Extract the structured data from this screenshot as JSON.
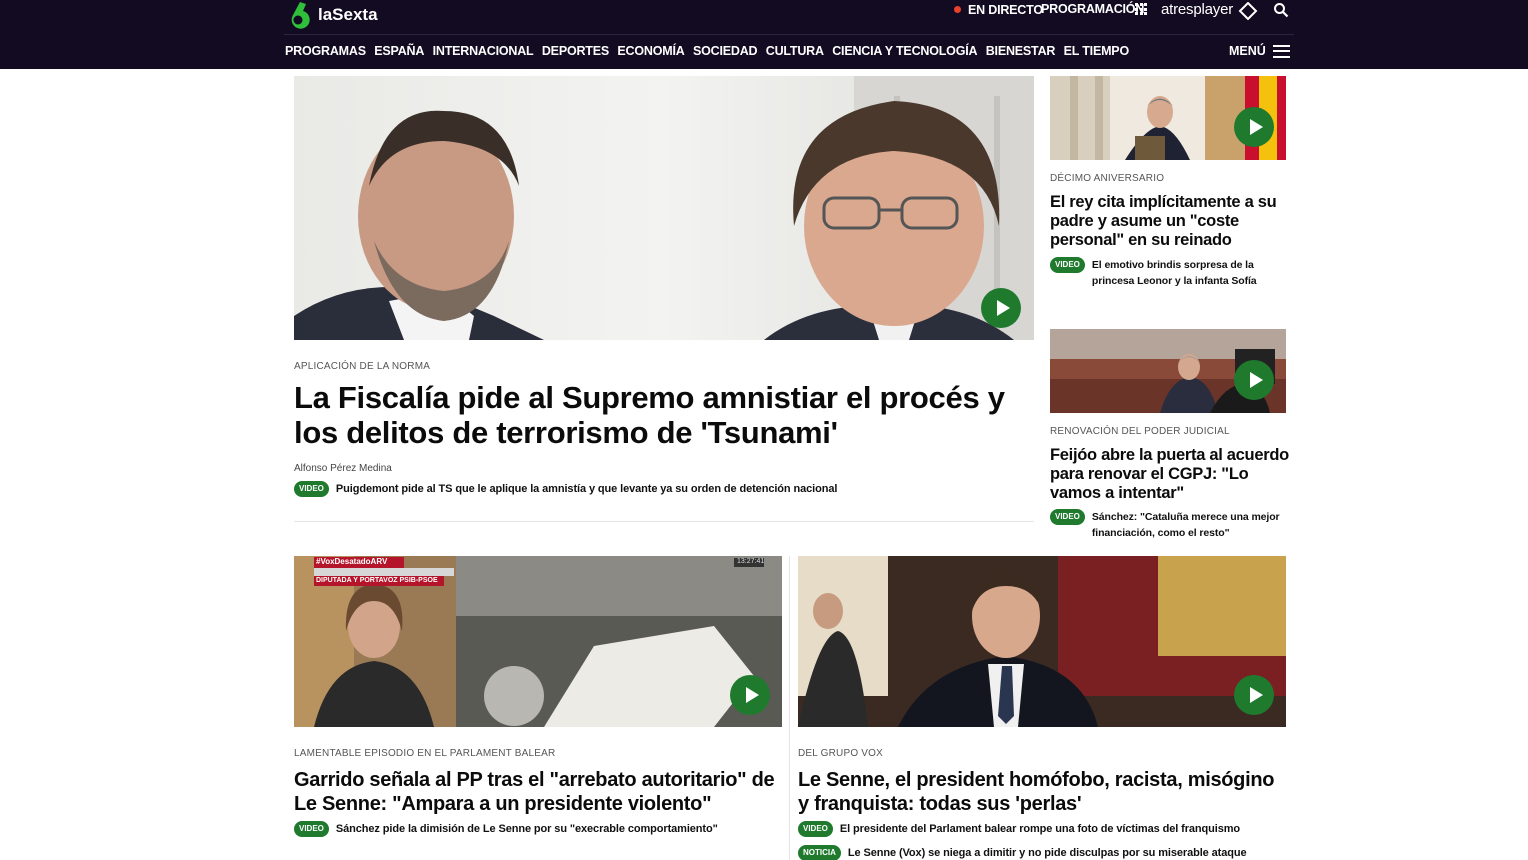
{
  "brand": {
    "name": "laSexta"
  },
  "header": {
    "live_label": "EN DIRECTO",
    "programming_label": "PROGRAMACIÓN",
    "atresplayer_label": "atresplayer",
    "menu_label": "MENÚ",
    "live_color": "#e8412c",
    "background": "#120b22"
  },
  "nav": {
    "items": [
      "PROGRAMAS",
      "ESPAÑA",
      "INTERNACIONAL",
      "DEPORTES",
      "ECONOMÍA",
      "SOCIEDAD",
      "CULTURA",
      "CIENCIA Y TECNOLOGÍA",
      "BIENESTAR",
      "EL TIEMPO"
    ]
  },
  "main_story": {
    "kicker": "APLICACIÓN DE LA NORMA",
    "headline": "La Fiscalía pide al Supremo amnistiar el procés y los delitos de terrorismo de 'Tsunami'",
    "author": "Alfonso Pérez Medina",
    "related": {
      "tag": "VIDEO",
      "text": "Puigdemont pide al TS que le aplique la amnistía y que levante ya su orden de detención nacional"
    }
  },
  "side_stories": [
    {
      "kicker": "DÉCIMO ANIVERSARIO",
      "headline": "El rey cita implícitamente a su padre y asume un \"coste personal\" en su reinado",
      "related": {
        "tag": "VIDEO",
        "text": "El emotivo brindis sorpresa de la princesa Leonor y la infanta Sofía"
      }
    },
    {
      "kicker": "RENOVACIÓN DEL PODER JUDICIAL",
      "headline": "Feijóo abre la puerta al acuerdo para renovar el CGPJ: \"Lo vamos a intentar\"",
      "related": {
        "tag": "VIDEO",
        "text": "Sánchez: \"Cataluña merece una mejor financiación, como el resto\""
      }
    }
  ],
  "bottom_stories": [
    {
      "kicker": "LAMENTABLE EPISODIO EN EL PARLAMENT BALEAR",
      "headline": "Garrido señala al PP tras el \"arrebato autoritario\" de Le Senne: \"Ampara a un presidente violento\"",
      "overlay": {
        "hashtag": "#VoxDesatadoARV",
        "caption": "DIPUTADA Y PORTAVOZ PSIB-PSOE",
        "time": "13:27:41"
      },
      "related": [
        {
          "tag": "VIDEO",
          "text": "Sánchez pide la dimisión de Le Senne por su \"execrable comportamiento\""
        }
      ]
    },
    {
      "kicker": "DEL GRUPO VOX",
      "headline": "Le Senne, el president homófobo, racista, misógino y franquista: todas sus 'perlas'",
      "related": [
        {
          "tag": "VIDEO",
          "text": "El presidente del Parlament balear rompe una foto de víctimas del franquismo"
        },
        {
          "tag": "NOTICIA",
          "text": "Le Senne (Vox) se niega a dimitir y no pide disculpas por su miserable ataque"
        }
      ]
    }
  ],
  "colors": {
    "accent_green": "#1f7a2e"
  }
}
